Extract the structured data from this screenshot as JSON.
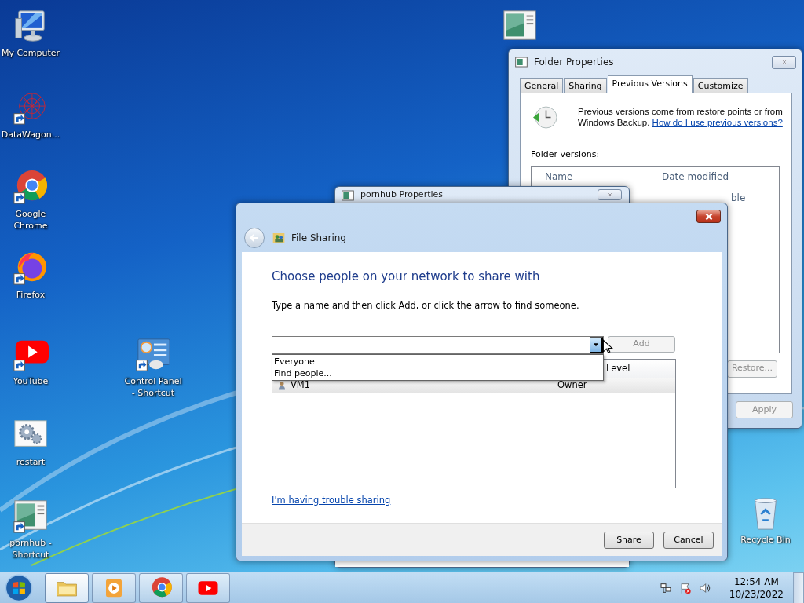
{
  "desktop_icons": [
    {
      "kind": "computer",
      "label": "My Computer",
      "shortcut": false
    },
    {
      "kind": "network",
      "label": "DataWagon...",
      "shortcut": true
    },
    {
      "kind": "chrome",
      "label": "Google Chrome",
      "shortcut": true
    },
    {
      "kind": "firefox",
      "label": "Firefox",
      "shortcut": true
    },
    {
      "kind": "youtube",
      "label": "YouTube",
      "shortcut": true
    },
    {
      "kind": "control-panel",
      "label": "Control Panel - Shortcut",
      "shortcut": true
    },
    {
      "kind": "gears",
      "label": "restart",
      "shortcut": false
    },
    {
      "kind": "folder-window",
      "label": "pornhub - Shortcut",
      "shortcut": true
    },
    {
      "kind": "recycle-bin",
      "label": "Recycle Bin",
      "shortcut": false
    },
    {
      "kind": "folder-window",
      "shortcut": false
    }
  ],
  "folder_properties": {
    "title": "Folder Properties",
    "tabs": [
      {
        "label": "General",
        "selected": false
      },
      {
        "label": "Sharing",
        "selected": false
      },
      {
        "label": "Previous Versions",
        "selected": true
      },
      {
        "label": "Customize",
        "selected": false
      }
    ],
    "description": "Previous versions come from restore points or from Windows Backup.",
    "help_link": "How do I use previous versions?",
    "section_label": "Folder versions:",
    "columns": [
      "Name",
      "Date modified"
    ],
    "list_fragment": "ble",
    "restore_button": {
      "label": "Restore...",
      "disabled": true
    },
    "apply_button": {
      "label": "Apply",
      "disabled": true
    }
  },
  "back_window": {
    "title": "pornhub Properties"
  },
  "file_sharing": {
    "title": "File Sharing",
    "heading": "Choose people on your network to share with",
    "instruction": "Type a name and then click Add, or click the arrow to find someone.",
    "dropdown_options": [
      "Everyone",
      "Find people..."
    ],
    "add_button": {
      "label": "Add",
      "disabled": true
    },
    "table": {
      "columns": [
        "Level"
      ],
      "rows": [
        {
          "name": "VM1",
          "level": "Owner",
          "selected": true
        }
      ]
    },
    "trouble_link": "I'm having trouble sharing",
    "buttons": [
      {
        "label": "Share"
      },
      {
        "label": "Cancel"
      }
    ]
  },
  "taskbar": {
    "items": [
      {
        "kind": "explorer",
        "active": true
      },
      {
        "kind": "media-player",
        "active": false
      },
      {
        "kind": "chrome",
        "active": false
      },
      {
        "kind": "youtube",
        "active": false
      }
    ],
    "tray": [
      {
        "kind": "network"
      },
      {
        "kind": "action-center"
      },
      {
        "kind": "volume"
      }
    ],
    "time": "12:54 AM",
    "date": "10/23/2022"
  }
}
